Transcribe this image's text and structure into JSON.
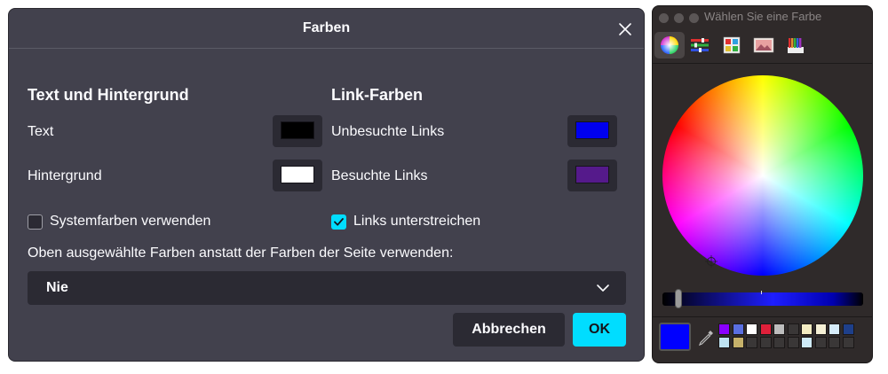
{
  "dialog": {
    "title": "Farben",
    "section_text_bg": "Text und Hintergrund",
    "section_links": "Link-Farben",
    "text_label": "Text",
    "background_label": "Hintergrund",
    "unvisited_label": "Unbesuchte Links",
    "visited_label": "Besuchte Links",
    "system_colors_label": "Systemfarben verwenden",
    "system_colors_checked": false,
    "underline_label": "Links unterstreichen",
    "underline_checked": true,
    "override_label": "Oben ausgewählte Farben anstatt der Farben der Seite verwenden:",
    "override_value": "Nie",
    "cancel_label": "Abbrechen",
    "ok_label": "OK",
    "colors": {
      "text": "#000000",
      "background": "#ffffff",
      "unvisited": "#0000ee",
      "visited": "#551a8b"
    }
  },
  "picker": {
    "title": "Wählen Sie eine Farbe",
    "modes": [
      "color-wheel-icon",
      "color-sliders-icon",
      "color-palettes-icon",
      "image-palettes-icon",
      "pencils-icon"
    ],
    "selected_mode": "color-wheel-icon",
    "current_color": "#0000ff",
    "brightness_level": 0.08,
    "palette_colors": [
      "#8a00ff",
      "#5a6fe0",
      "#ffffff",
      "#e0203a",
      "#bdbdbd",
      "#3a3737",
      "#f3ecc2",
      "#f5f0d5",
      "#d6ecfa",
      "#1e3f8a",
      "#bfe3f2",
      "#c6b16a",
      "#3a3737",
      "#3a3737",
      "#3a3737",
      "#3a3737",
      "#cfeaf7",
      "#3a3737",
      "#3a3737",
      "#3a3737"
    ]
  }
}
